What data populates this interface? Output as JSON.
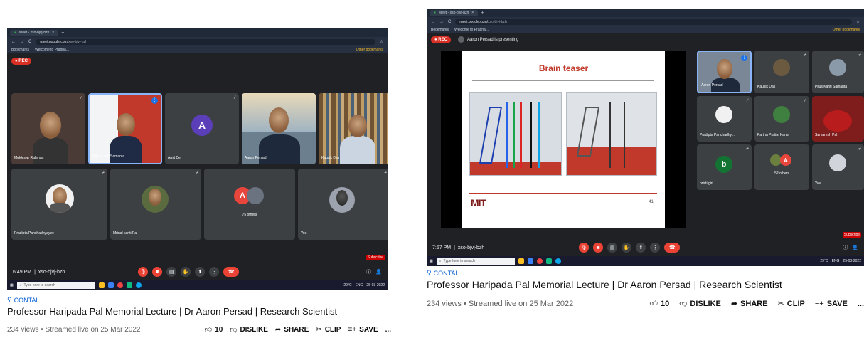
{
  "browser": {
    "tab_title": "Meet - xso-bjvj-bzh",
    "url_host": "meet.google.com/",
    "url_path": "xso-bjvj-bzh",
    "bookmarks_label": "Bookmarks",
    "welcome_label": "Welcome to Prabha...",
    "other_bookmarks": "Other bookmarks"
  },
  "meet": {
    "rec_label": "REC",
    "meeting_code": "xso-bjvj-bzh",
    "left_time": "6:49 PM",
    "right_time": "7:57 PM",
    "presenting_text": "Aaron Persad is presenting",
    "left_tiles": [
      {
        "name": "Mukleswr Rahman"
      },
      {
        "name": "Pijus Kanti Samanta"
      },
      {
        "name": "Amit De",
        "initial": "A"
      },
      {
        "name": "Aaron Persad"
      },
      {
        "name": "Kausik Das"
      },
      {
        "name": "Pradipta Panchadhyayee"
      },
      {
        "name": "Mrinal kanti Pal"
      },
      {
        "name": "75 others",
        "initial": "A"
      },
      {
        "name": "You"
      }
    ],
    "right_tiles": [
      {
        "name": "Aaron Persad"
      },
      {
        "name": "Kausik Das"
      },
      {
        "name": "Pijus Kanti Samanta"
      },
      {
        "name": "Pradipta Panchadhy..."
      },
      {
        "name": "Partha Pratim Karan"
      },
      {
        "name": "Samaresh Pal"
      },
      {
        "name": "bristi giri",
        "initial": "b"
      },
      {
        "name": "52 others"
      },
      {
        "name": "You"
      }
    ],
    "slide_title": "Brain teaser",
    "slide_logo": "MIT",
    "slide_page": "41"
  },
  "taskbar": {
    "search_placeholder": "Type here to search",
    "temp": "29°C",
    "lang": "ENG",
    "left_clock": "0640\n25-03-2022",
    "right_clock": "25-03-2022",
    "subscribe": "Subscribe"
  },
  "video": {
    "channel": "CONTAI",
    "title": "Professor Haripada Pal Memorial Lecture | Dr Aaron Persad | Research Scientist",
    "stats": "234 views • Streamed live on 25 Mar 2022",
    "likes": "10",
    "dislike_label": "DISLIKE",
    "share_label": "SHARE",
    "clip_label": "CLIP",
    "save_label": "SAVE",
    "more_label": "..."
  },
  "colors": {
    "accent_red": "#ea4335",
    "link_blue": "#065fd4",
    "meet_bg": "#202124"
  }
}
